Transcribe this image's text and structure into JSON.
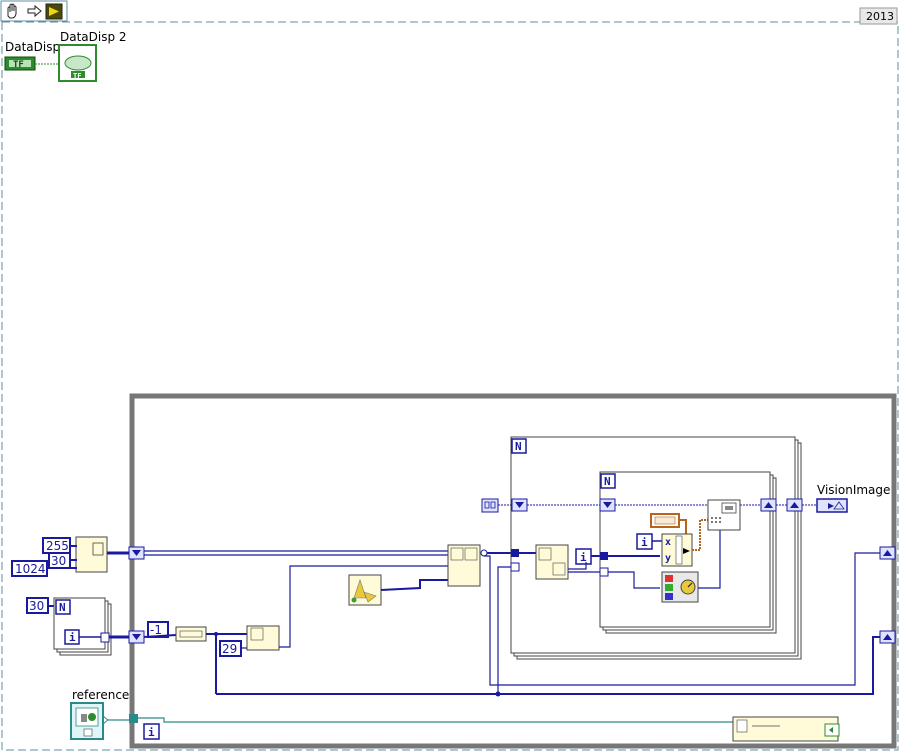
{
  "toolbar": {
    "version": "2013",
    "icons": [
      "hand-icon",
      "arrow-icon",
      "run-icon"
    ]
  },
  "labels": {
    "datadisp": "DataDisp",
    "datadisp2": "DataDisp 2",
    "visionimage": "VisionImage",
    "reference": "reference"
  },
  "constants": {
    "c255": "255",
    "c1024": "1024",
    "c30a": "30",
    "c30b": "30",
    "cneg1": "-1",
    "c29": "29"
  },
  "terminals": {
    "tf": "TF",
    "n_outer": "N",
    "n_mid": "N",
    "n_inner": "N",
    "i": "i",
    "x": "x",
    "y": "y"
  },
  "colors": {
    "wire_blue": "#1a1a9e",
    "frame_gray": "#777777",
    "node_fill": "#fffbd9",
    "boolean_green": "#2e8b2e",
    "cluster_orange": "#b5651d",
    "dashed_border": "#5f8f9f"
  }
}
